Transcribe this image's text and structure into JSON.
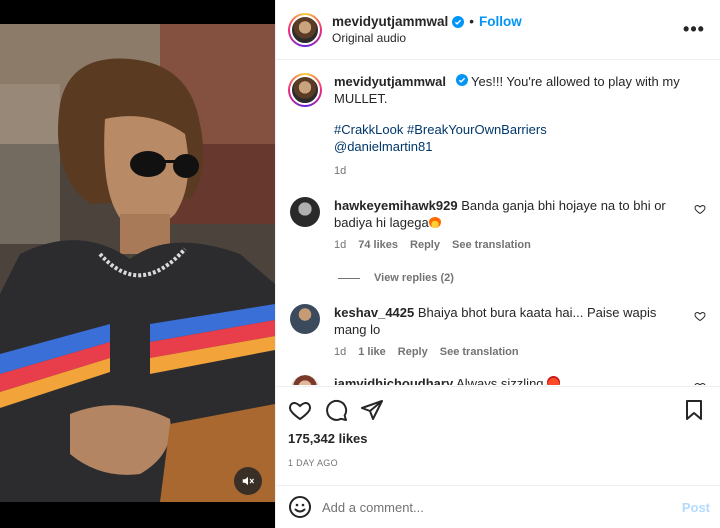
{
  "post": {
    "username": "mevidyutjammwal",
    "follow_label": "Follow",
    "dot": "•",
    "audio_label": "Original audio",
    "more_label": "•••"
  },
  "caption": {
    "username": "mevidyutjammwal",
    "text": "Yes!!! You're allowed to play with my MULLET.",
    "hashtags": [
      "#CrakkLook",
      "#BreakYourOwnBarriers"
    ],
    "mention": "@danielmartin81",
    "age": "1d"
  },
  "comments": [
    {
      "username": "hawkeyemihawk929",
      "text": "Banda ganja bhi hojaye na to bhi or badiya hi lagega",
      "emoji": "fire-emoji",
      "age": "1d",
      "likes": "74 likes",
      "reply": "Reply",
      "translate": "See translation",
      "view_replies": "View replies (2)"
    },
    {
      "username": "keshav_4425",
      "text": "Bhaiya bhot bura kaata hai... Paise wapis mang lo",
      "age": "1d",
      "likes": "1 like",
      "reply": "Reply",
      "translate": "See translation"
    },
    {
      "username": "iamvidhichoudhary",
      "text": "Always sizzling",
      "emoji": "devil-emoji"
    }
  ],
  "stats": {
    "likes": "175,342 likes",
    "date": "1 DAY AGO"
  },
  "composer": {
    "placeholder": "Add a comment...",
    "post_label": "Post"
  },
  "colors": {
    "accent": "#0095f6",
    "link": "#00376b",
    "muted": "#737373"
  }
}
